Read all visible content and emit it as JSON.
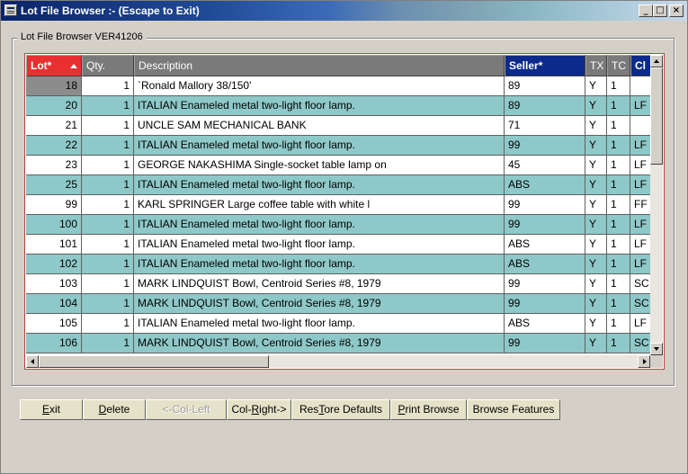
{
  "window": {
    "title": "Lot File Browser :- (Escape to Exit)",
    "controls": {
      "minimize": "_",
      "maximize": "□",
      "close": "×"
    }
  },
  "group": {
    "label": "Lot File Browser VER41206"
  },
  "grid": {
    "columns": [
      {
        "key": "lot",
        "label": "Lot*",
        "state": "sorted-asc"
      },
      {
        "key": "qty",
        "label": "Qty.",
        "state": "normal"
      },
      {
        "key": "description",
        "label": "Description",
        "state": "normal"
      },
      {
        "key": "seller",
        "label": "Seller*",
        "state": "keyed"
      },
      {
        "key": "tx",
        "label": "TX",
        "state": "normal"
      },
      {
        "key": "tc",
        "label": "TC",
        "state": "normal"
      },
      {
        "key": "cl",
        "label": "Cl",
        "state": "keyed"
      }
    ],
    "rows": [
      {
        "lot": "18",
        "qty": "1",
        "description": "`Ronald Mallory 38/150'",
        "seller": "89",
        "tx": "Y",
        "tc": "1",
        "cl": ""
      },
      {
        "lot": "20",
        "qty": "1",
        "description": "ITALIAN Enameled metal two-light floor lamp.",
        "seller": "89",
        "tx": "Y",
        "tc": "1",
        "cl": "LF"
      },
      {
        "lot": "21",
        "qty": "1",
        "description": "UNCLE SAM MECHANICAL BANK",
        "seller": "71",
        "tx": "Y",
        "tc": "1",
        "cl": ""
      },
      {
        "lot": "22",
        "qty": "1",
        "description": "ITALIAN Enameled metal two-light floor lamp.",
        "seller": "99",
        "tx": "Y",
        "tc": "1",
        "cl": "LF"
      },
      {
        "lot": "23",
        "qty": "1",
        "description": "GEORGE NAKASHIMA Single-socket table lamp on",
        "seller": "45",
        "tx": "Y",
        "tc": "1",
        "cl": "LF"
      },
      {
        "lot": "25",
        "qty": "1",
        "description": "ITALIAN Enameled metal two-light floor lamp.",
        "seller": "ABS",
        "tx": "Y",
        "tc": "1",
        "cl": "LF"
      },
      {
        "lot": "99",
        "qty": "1",
        "description": "KARL SPRINGER Large coffee table with white l",
        "seller": "99",
        "tx": "Y",
        "tc": "1",
        "cl": "FF"
      },
      {
        "lot": "100",
        "qty": "1",
        "description": "ITALIAN Enameled metal two-light floor lamp.",
        "seller": "99",
        "tx": "Y",
        "tc": "1",
        "cl": "LF"
      },
      {
        "lot": "101",
        "qty": "1",
        "description": "ITALIAN Enameled metal two-light floor lamp.",
        "seller": "ABS",
        "tx": "Y",
        "tc": "1",
        "cl": "LF"
      },
      {
        "lot": "102",
        "qty": "1",
        "description": "ITALIAN Enameled metal two-light floor lamp.",
        "seller": "ABS",
        "tx": "Y",
        "tc": "1",
        "cl": "LF"
      },
      {
        "lot": "103",
        "qty": "1",
        "description": "MARK LINDQUIST Bowl, Centroid Series #8, 1979",
        "seller": "99",
        "tx": "Y",
        "tc": "1",
        "cl": "SC"
      },
      {
        "lot": "104",
        "qty": "1",
        "description": "MARK LINDQUIST Bowl, Centroid Series #8, 1979",
        "seller": "99",
        "tx": "Y",
        "tc": "1",
        "cl": "SC"
      },
      {
        "lot": "105",
        "qty": "1",
        "description": "ITALIAN Enameled metal two-light floor lamp.",
        "seller": "ABS",
        "tx": "Y",
        "tc": "1",
        "cl": "LF"
      },
      {
        "lot": "106",
        "qty": "1",
        "description": "MARK LINDQUIST Bowl, Centroid Series #8, 1979",
        "seller": "99",
        "tx": "Y",
        "tc": "1",
        "cl": "SC"
      }
    ]
  },
  "buttons": [
    {
      "id": "exit",
      "label": "Exit",
      "accel": "E",
      "enabled": true
    },
    {
      "id": "delete",
      "label": "Delete",
      "accel": "D",
      "enabled": true
    },
    {
      "id": "col-left",
      "label": "<-Col-Left",
      "accel": "",
      "enabled": false
    },
    {
      "id": "col-right",
      "label": "Col-Right->",
      "accel": "R",
      "enabled": true
    },
    {
      "id": "restore-defaults",
      "label": "ResTore Defaults",
      "accel": "T",
      "enabled": true
    },
    {
      "id": "print-browse",
      "label": "Print Browse",
      "accel": "P",
      "enabled": true
    },
    {
      "id": "browse-features",
      "label": "Browse Features",
      "accel": "",
      "enabled": true
    }
  ]
}
